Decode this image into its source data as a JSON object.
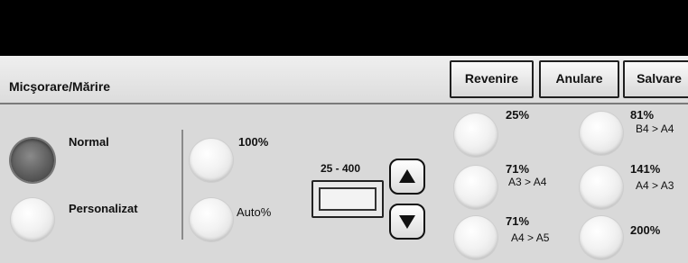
{
  "header": {
    "title": "Micşorare/Mărire",
    "buttons": {
      "revenire": "Revenire",
      "anulare": "Anulare",
      "salvare": "Salvare"
    }
  },
  "mode": {
    "normal": "Normal",
    "personalizat": "Personalizat",
    "selected": "Normal"
  },
  "quick": {
    "p100": "100%",
    "auto": "Auto%"
  },
  "range": {
    "label": "25 - 400",
    "value": ""
  },
  "presets": {
    "p25": {
      "pct": "25%",
      "sub": ""
    },
    "p71a": {
      "pct": "71%",
      "sub": "A3 > A4"
    },
    "p71b": {
      "pct": "71%",
      "sub": "A4 > A5"
    },
    "p81": {
      "pct": "81%",
      "sub": "B4 > A4"
    },
    "p141": {
      "pct": "141%",
      "sub": "A4 > A3"
    },
    "p200": {
      "pct": "200%",
      "sub": ""
    }
  },
  "icons": {
    "up": "arrow-up-icon",
    "down": "arrow-down-icon"
  }
}
